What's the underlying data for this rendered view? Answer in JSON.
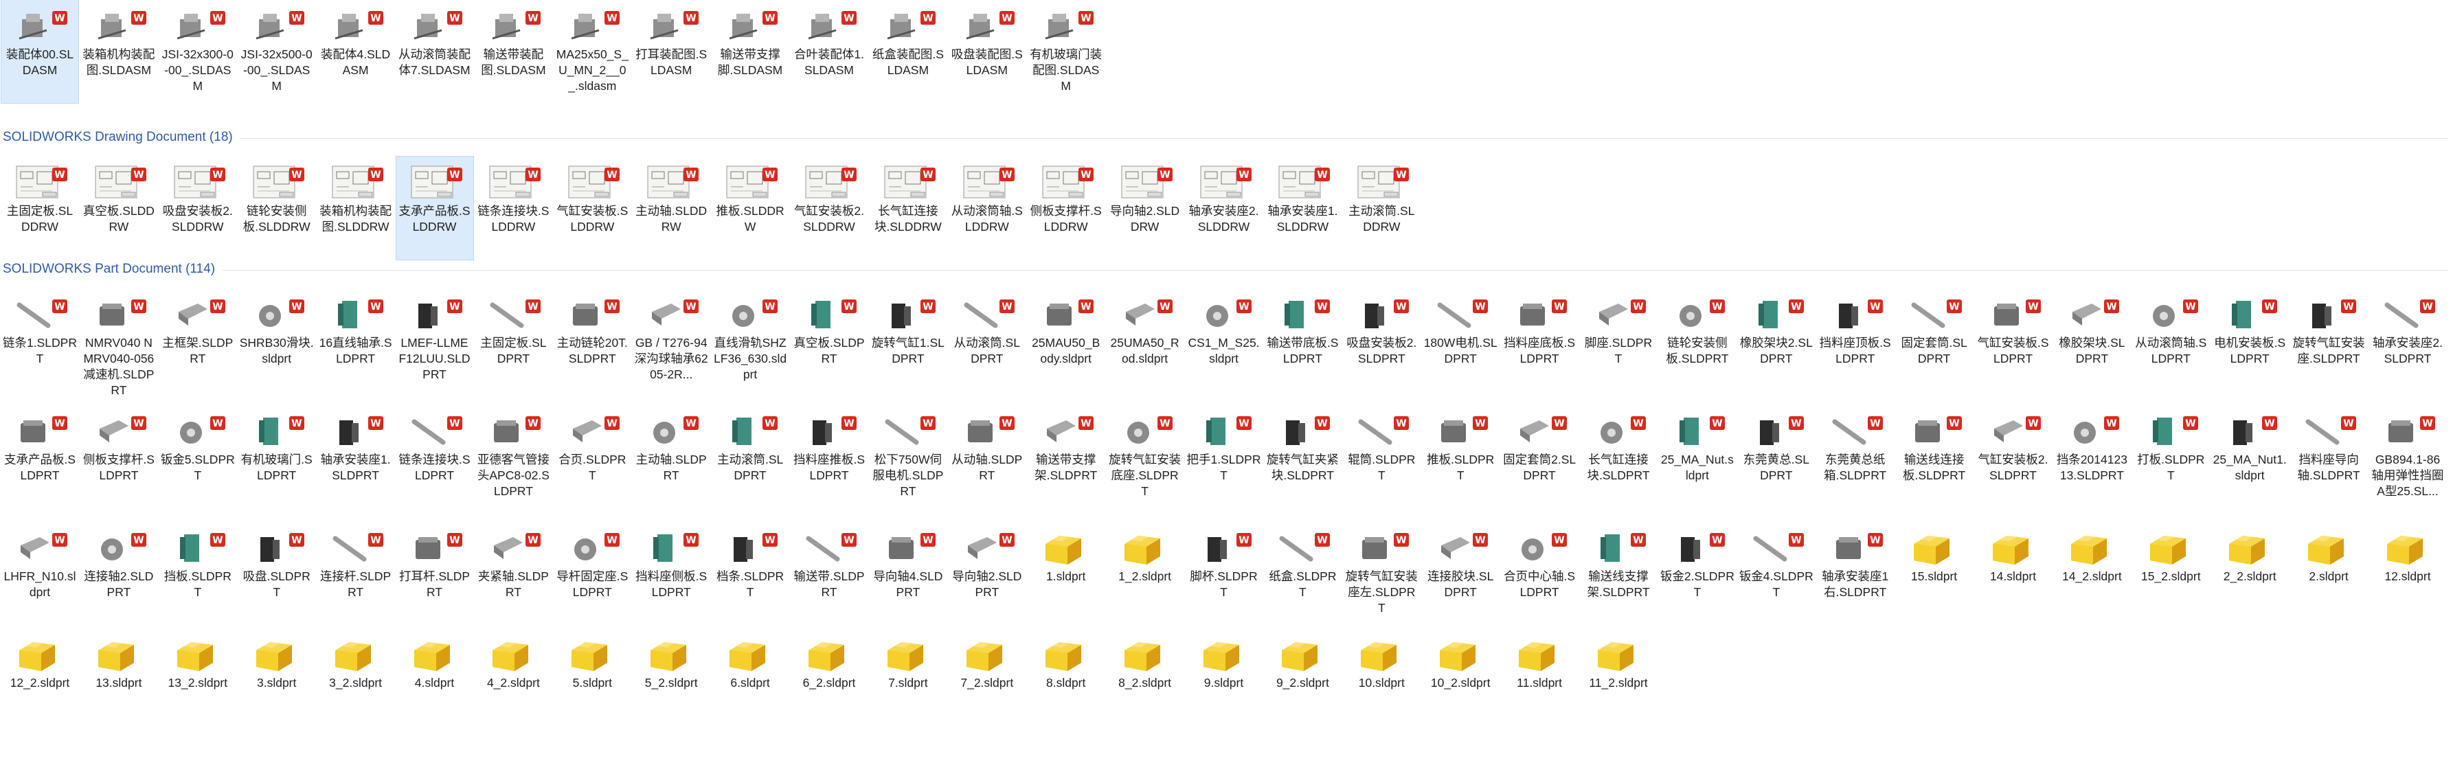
{
  "sections": [
    {
      "header": "",
      "items": [
        {
          "label": "装配体00.SLDASM",
          "type": "asm",
          "selected": true
        },
        {
          "label": "装箱机构装配图.SLDASM",
          "type": "asm"
        },
        {
          "label": "JSI-32x300-0-00_.SLDASM",
          "type": "asm"
        },
        {
          "label": "JSI-32x500-0-00_.SLDASM",
          "type": "asm"
        },
        {
          "label": "装配体4.SLDASM",
          "type": "asm"
        },
        {
          "label": "从动滚筒装配体7.SLDASM",
          "type": "asm"
        },
        {
          "label": "输送带装配图.SLDASM",
          "type": "asm"
        },
        {
          "label": "MA25x50_S_U_MN_2__0_.sldasm",
          "type": "asm"
        },
        {
          "label": "打耳装配图.SLDASM",
          "type": "asm"
        },
        {
          "label": "输送带支撑脚.SLDASM",
          "type": "asm"
        },
        {
          "label": "合叶装配体1.SLDASM",
          "type": "asm"
        },
        {
          "label": "纸盒装配图.SLDASM",
          "type": "asm"
        },
        {
          "label": "吸盘装配图.SLDASM",
          "type": "asm"
        },
        {
          "label": "有机玻璃门装配图.SLDASM",
          "type": "asm"
        }
      ]
    },
    {
      "header": "SOLIDWORKS Drawing Document (18)",
      "items": [
        {
          "label": "主固定板.SLDDRW",
          "type": "drw"
        },
        {
          "label": "真空板.SLDDRW",
          "type": "drw"
        },
        {
          "label": "吸盘安装板2.SLDDRW",
          "type": "drw"
        },
        {
          "label": "链轮安装侧板.SLDDRW",
          "type": "drw"
        },
        {
          "label": "装箱机构装配图.SLDDRW",
          "type": "drw"
        },
        {
          "label": "支承产品板.SLDDRW",
          "type": "drw",
          "selected": true
        },
        {
          "label": "链条连接块.SLDDRW",
          "type": "drw"
        },
        {
          "label": "气缸安装板.SLDDRW",
          "type": "drw"
        },
        {
          "label": "主动轴.SLDDRW",
          "type": "drw"
        },
        {
          "label": "推板.SLDDRW",
          "type": "drw"
        },
        {
          "label": "气缸安装板2.SLDDRW",
          "type": "drw"
        },
        {
          "label": "长气缸连接块.SLDDRW",
          "type": "drw"
        },
        {
          "label": "从动滚筒轴.SLDDRW",
          "type": "drw"
        },
        {
          "label": "侧板支撑杆.SLDDRW",
          "type": "drw"
        },
        {
          "label": "导向轴2.SLDDRW",
          "type": "drw"
        },
        {
          "label": "轴承安装座2.SLDDRW",
          "type": "drw"
        },
        {
          "label": "轴承安装座1.SLDDRW",
          "type": "drw"
        },
        {
          "label": "主动滚筒.SLDDRW",
          "type": "drw"
        }
      ]
    },
    {
      "header": "SOLIDWORKS Part Document (114)",
      "items": [
        {
          "label": "链条1.SLDPRT",
          "type": "part"
        },
        {
          "label": "NMRV040 NMRV040-056减速机.SLDPRT",
          "type": "part"
        },
        {
          "label": "主框架.SLDPRT",
          "type": "part"
        },
        {
          "label": "SHRB30滑块.sldprt",
          "type": "part"
        },
        {
          "label": "16直线轴承.SLDPRT",
          "type": "part"
        },
        {
          "label": "LMEF-LLMEF12LUU.SLDPRT",
          "type": "part"
        },
        {
          "label": "主固定板.SLDPRT",
          "type": "part"
        },
        {
          "label": "主动链轮20T.SLDPRT",
          "type": "part"
        },
        {
          "label": "GB / T276-94深沟球轴承6205-2R...",
          "type": "part"
        },
        {
          "label": "直线滑轨SHZLF36_630.sldprt",
          "type": "part"
        },
        {
          "label": "真空板.SLDPRT",
          "type": "part"
        },
        {
          "label": "旋转气缸1.SLDPRT",
          "type": "part"
        },
        {
          "label": "从动滚筒.SLDPRT",
          "type": "part"
        },
        {
          "label": "25MAU50_Body.sldprt",
          "type": "part"
        },
        {
          "label": "25UMA50_Rod.sldprt",
          "type": "part"
        },
        {
          "label": "CS1_M_S25.sldprt",
          "type": "part"
        },
        {
          "label": "输送带底板.SLDPRT",
          "type": "part"
        },
        {
          "label": "吸盘安装板2.SLDPRT",
          "type": "part"
        },
        {
          "label": "180W电机.SLDPRT",
          "type": "part"
        },
        {
          "label": "挡料座底板.SLDPRT",
          "type": "part"
        },
        {
          "label": "脚座.SLDPRT",
          "type": "part"
        },
        {
          "label": "链轮安装侧板.SLDPRT",
          "type": "part"
        },
        {
          "label": "橡胶架块2.SLDPRT",
          "type": "part"
        },
        {
          "label": "挡料座顶板.SLDPRT",
          "type": "part"
        },
        {
          "label": "固定套筒.SLDPRT",
          "type": "part"
        },
        {
          "label": "气缸安装板.SLDPRT",
          "type": "part"
        },
        {
          "label": "橡胶架块.SLDPRT",
          "type": "part"
        },
        {
          "label": "从动滚筒轴.SLDPRT",
          "type": "part"
        },
        {
          "label": "电机安装板.SLDPRT",
          "type": "part"
        },
        {
          "label": "旋转气缸安装座.SLDPRT",
          "type": "part"
        },
        {
          "label": "轴承安装座2.SLDPRT",
          "type": "part"
        },
        {
          "label": "支承产品板.SLDPRT",
          "type": "part"
        },
        {
          "label": "侧板支撑杆.SLDPRT",
          "type": "part"
        },
        {
          "label": "钣金5.SLDPRT",
          "type": "part"
        },
        {
          "label": "有机玻璃门.SLDPRT",
          "type": "part"
        },
        {
          "label": "轴承安装座1.SLDPRT",
          "type": "part"
        },
        {
          "label": "链条连接块.SLDPRT",
          "type": "part"
        },
        {
          "label": "亚德客气管接头APC8-02.SLDPRT",
          "type": "part"
        },
        {
          "label": "合页.SLDPRT",
          "type": "part"
        },
        {
          "label": "主动轴.SLDPRT",
          "type": "part"
        },
        {
          "label": "主动滚筒.SLDPRT",
          "type": "part"
        },
        {
          "label": "挡料座推板.SLDPRT",
          "type": "part"
        },
        {
          "label": "松下750W伺服电机.SLDPRT",
          "type": "part"
        },
        {
          "label": "从动轴.SLDPRT",
          "type": "part"
        },
        {
          "label": "输送带支撑架.SLDPRT",
          "type": "part"
        },
        {
          "label": "旋转气缸安装底座.SLDPRT",
          "type": "part"
        },
        {
          "label": "把手1.SLDPRT",
          "type": "part"
        },
        {
          "label": "旋转气缸夹紧块.SLDPRT",
          "type": "part"
        },
        {
          "label": "辊筒.SLDPRT",
          "type": "part"
        },
        {
          "label": "推板.SLDPRT",
          "type": "part"
        },
        {
          "label": "固定套筒2.SLDPRT",
          "type": "part"
        },
        {
          "label": "长气缸连接块.SLDPRT",
          "type": "part"
        },
        {
          "label": "25_MA_Nut.sldprt",
          "type": "part"
        },
        {
          "label": "东莞黄总.SLDPRT",
          "type": "part"
        },
        {
          "label": "东莞黄总纸箱.SLDPRT",
          "type": "part"
        },
        {
          "label": "输送线连接板.SLDPRT",
          "type": "part"
        },
        {
          "label": "气缸安装板2.SLDPRT",
          "type": "part"
        },
        {
          "label": "挡条201412313.SLDPRT",
          "type": "part"
        },
        {
          "label": "打板.SLDPRT",
          "type": "part"
        },
        {
          "label": "25_MA_Nut1.sldprt",
          "type": "part"
        },
        {
          "label": "挡料座导向轴.SLDPRT",
          "type": "part"
        },
        {
          "label": "GB894.1-86轴用弹性挡圈A型25.SL...",
          "type": "part"
        },
        {
          "label": "LHFR_N10.sldprt",
          "type": "part"
        },
        {
          "label": "连接轴2.SLDPRT",
          "type": "part"
        },
        {
          "label": "挡板.SLDPRT",
          "type": "part"
        },
        {
          "label": "吸盘.SLDPRT",
          "type": "part"
        },
        {
          "label": "连接杆.SLDPRT",
          "type": "part"
        },
        {
          "label": "打耳杆.SLDPRT",
          "type": "part"
        },
        {
          "label": "夹紧轴.SLDPRT",
          "type": "part"
        },
        {
          "label": "导杆固定座.SLDPRT",
          "type": "part"
        },
        {
          "label": "挡料座侧板.SLDPRT",
          "type": "part"
        },
        {
          "label": "档条.SLDPRT",
          "type": "part"
        },
        {
          "label": "输送带.SLDPRT",
          "type": "part"
        },
        {
          "label": "导向轴4.SLDPRT",
          "type": "part"
        },
        {
          "label": "导向轴2.SLDPRT",
          "type": "part"
        },
        {
          "label": "1.sldprt",
          "type": "folder"
        },
        {
          "label": "1_2.sldprt",
          "type": "folder"
        },
        {
          "label": "脚杯.SLDPRT",
          "type": "part"
        },
        {
          "label": "纸盒.SLDPRT",
          "type": "part"
        },
        {
          "label": "旋转气缸安装座左.SLDPRT",
          "type": "part"
        },
        {
          "label": "连接胶块.SLDPRT",
          "type": "part"
        },
        {
          "label": "合页中心轴.SLDPRT",
          "type": "part"
        },
        {
          "label": "输送线支撑架.SLDPRT",
          "type": "part"
        },
        {
          "label": "钣金2.SLDPRT",
          "type": "part"
        },
        {
          "label": "钣金4.SLDPRT",
          "type": "part"
        },
        {
          "label": "轴承安装座1右.SLDPRT",
          "type": "part"
        },
        {
          "label": "15.sldprt",
          "type": "folder"
        },
        {
          "label": "14.sldprt",
          "type": "folder"
        },
        {
          "label": "14_2.sldprt",
          "type": "folder"
        },
        {
          "label": "15_2.sldprt",
          "type": "folder"
        },
        {
          "label": "2_2.sldprt",
          "type": "folder"
        },
        {
          "label": "2.sldprt",
          "type": "folder"
        },
        {
          "label": "12.sldprt",
          "type": "folder"
        },
        {
          "label": "12_2.sldprt",
          "type": "folder"
        },
        {
          "label": "13.sldprt",
          "type": "folder"
        },
        {
          "label": "13_2.sldprt",
          "type": "folder"
        },
        {
          "label": "3.sldprt",
          "type": "folder"
        },
        {
          "label": "3_2.sldprt",
          "type": "folder"
        },
        {
          "label": "4.sldprt",
          "type": "folder"
        },
        {
          "label": "4_2.sldprt",
          "type": "folder"
        },
        {
          "label": "5.sldprt",
          "type": "folder"
        },
        {
          "label": "5_2.sldprt",
          "type": "folder"
        },
        {
          "label": "6.sldprt",
          "type": "folder"
        },
        {
          "label": "6_2.sldprt",
          "type": "folder"
        },
        {
          "label": "7.sldprt",
          "type": "folder"
        },
        {
          "label": "7_2.sldprt",
          "type": "folder"
        },
        {
          "label": "8.sldprt",
          "type": "folder"
        },
        {
          "label": "8_2.sldprt",
          "type": "folder"
        },
        {
          "label": "9.sldprt",
          "type": "folder"
        },
        {
          "label": "9_2.sldprt",
          "type": "folder"
        },
        {
          "label": "10.sldprt",
          "type": "folder"
        },
        {
          "label": "10_2.sldprt",
          "type": "folder"
        },
        {
          "label": "11.sldprt",
          "type": "folder"
        },
        {
          "label": "11_2.sldprt",
          "type": "folder"
        }
      ]
    }
  ],
  "colors": {
    "header_text": "#2d5aa8",
    "selection": "#dcebfb",
    "badge_red": "#d62a1e",
    "folder_yellow": "#f5cf2b"
  }
}
